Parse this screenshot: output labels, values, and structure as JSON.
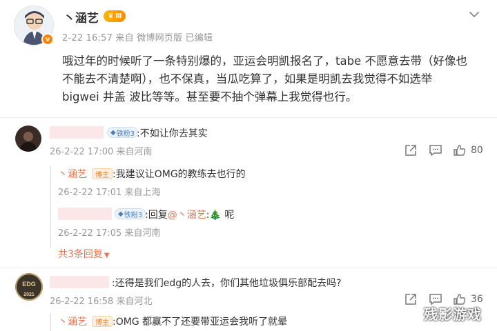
{
  "post": {
    "author": "丶涵艺",
    "level_badge": "Ⅲ",
    "verified_mark": "v",
    "meta": "2-22 16:57  来自 微博网页版  已编辑",
    "text_line1": "哦过年的时候听了一条特别爆的，亚运会明凯报名了，tabe 不愿意去带（好像也",
    "text_line2": "不能去不清楚啊），也不保真，当瓜吃算了，如果是明凯去我觉得不如选举",
    "text_line3": "bigwei 井盖 波比等等。甚至要不抽个弹幕上我觉得也行。"
  },
  "comments": [
    {
      "fan_badge": "铁粉3",
      "text": ":不如让你去其实",
      "meta": "26-2-22 17:00  来自河南",
      "likes": "80",
      "replies": [
        {
          "name": "丶涵艺",
          "badge": "博主",
          "text": ":我建议让OMG的教练去也行的",
          "meta": "26-2-22 17:01  来自上海"
        },
        {
          "fan_badge": "铁粉3",
          "text_prefix": ":回复",
          "mention": "@丶涵艺",
          "text_suffix": ":🎄 呢",
          "meta": "26-2-22 17:05  来自河南"
        }
      ],
      "more": "共3条回复"
    },
    {
      "avatar_text": "EDG",
      "avatar_year": "2021",
      "text": ":还得是我们edg的人去，你们其他垃圾俱乐部配去吗?",
      "meta": "26-2-22 16:58  来自河北",
      "likes": "36",
      "replies": [
        {
          "name": "丶涵艺",
          "badge": "博主",
          "text": ":OMG 都赢不了还要带亚运会我听了就晕"
        }
      ]
    }
  ],
  "watermark": "残影游戏",
  "colors": {
    "accent": "#eb7350",
    "meta": "#999999",
    "badge_blue": "#4a7fc4",
    "gold": "#ff8a00"
  }
}
